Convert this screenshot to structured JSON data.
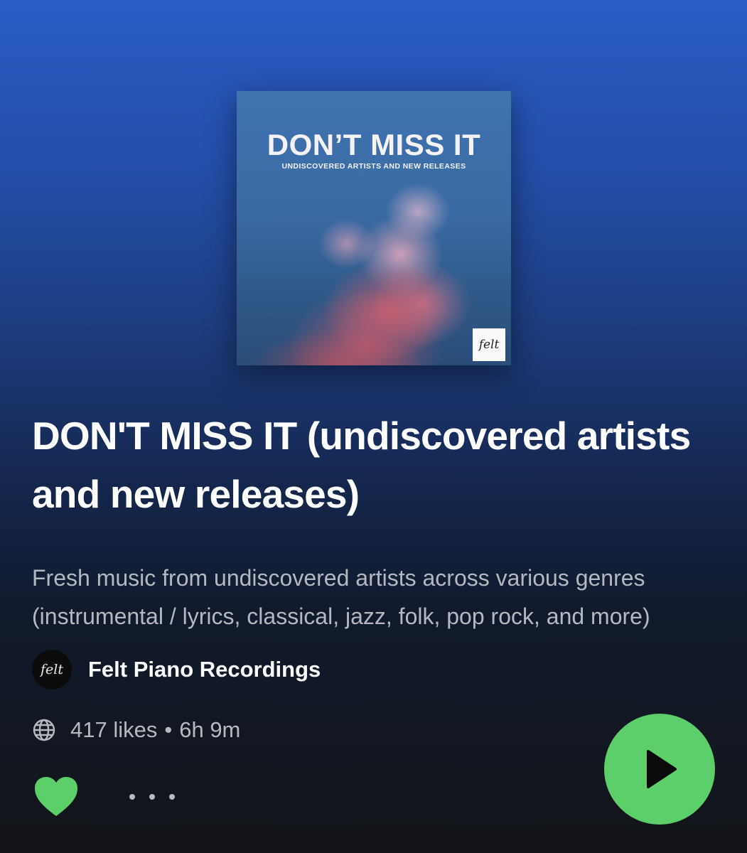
{
  "cover": {
    "title": "DON’T MISS IT",
    "subtitle": "UNDISCOVERED ARTISTS AND NEW RELEASES",
    "logo_text": "felt"
  },
  "playlist": {
    "title": "DON'T MISS IT (undiscovered artists and new releases)",
    "description": "Fresh music from undiscovered artists across various genres (instrumental / lyrics, classical, jazz, folk, pop rock, and more)"
  },
  "owner": {
    "name": "Felt Piano Recordings",
    "avatar_text": "felt"
  },
  "meta": {
    "likes": "417 likes",
    "separator": "•",
    "duration": "6h 9m",
    "visibility_icon": "globe-icon"
  },
  "actions": {
    "like_icon": "heart-icon",
    "liked": true,
    "more_icon": "more-options-icon",
    "play_icon": "play-icon"
  },
  "colors": {
    "accent": "#5ccf6a",
    "text_secondary": "#b4b8c0",
    "background_top": "#2a5cc4",
    "background_bottom": "#121418"
  }
}
